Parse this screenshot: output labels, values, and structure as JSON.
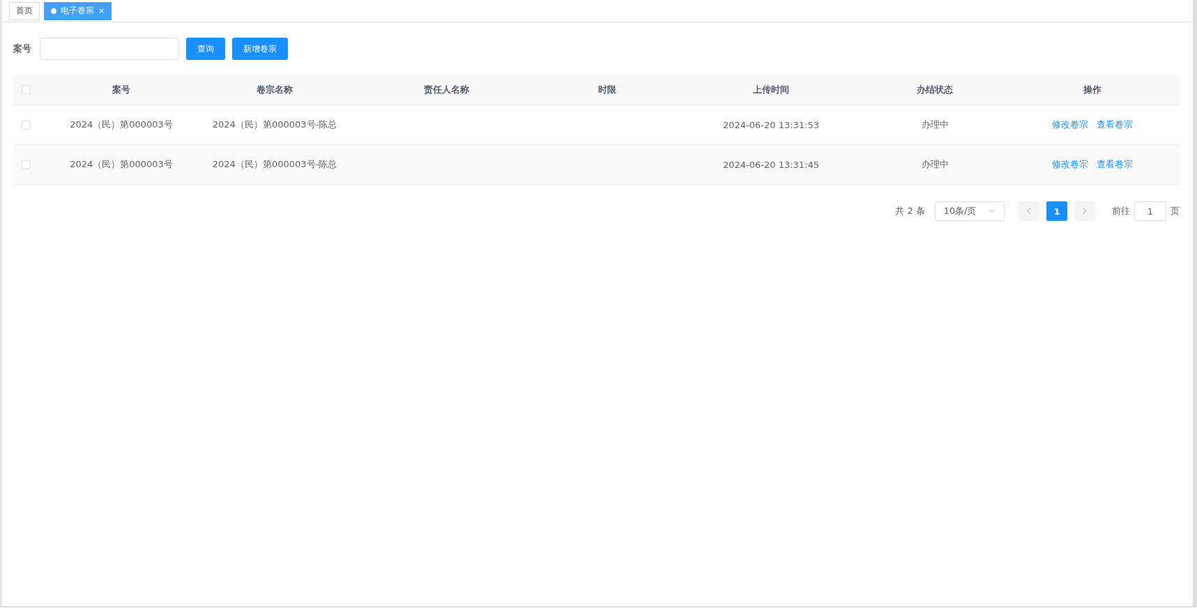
{
  "tabs": [
    {
      "label": "首页",
      "selected": false
    },
    {
      "label": "电子卷宗",
      "selected": true,
      "close": "×"
    }
  ],
  "search": {
    "label": "案号",
    "buttons": [
      "查询",
      "新增卷宗"
    ]
  },
  "table": {
    "select_all": {
      "checked": false
    },
    "columns": [
      "案号",
      "卷宗名称",
      "责任人名称",
      "时限",
      "上传时间",
      "办结状态",
      "操作"
    ],
    "rows": [
      {
        "checked": false,
        "cells": [
          "2024（民）第000003号",
          "2024（民）第000003号-陈总",
          "",
          "",
          "2024-06-20 13:31:53",
          "办理中"
        ],
        "actions": [
          "修改卷宗",
          "查看卷宗"
        ]
      },
      {
        "checked": false,
        "cells": [
          "2024（民）第000003号",
          "2024（民）第000003号-陈总",
          "",
          "",
          "2024-06-20 13:31:45",
          "办理中"
        ],
        "actions": [
          "修改卷宗",
          "查看卷宗"
        ]
      }
    ]
  },
  "pagination": {
    "total": "共 2 条",
    "page_size": "10条/页",
    "pages": [
      {
        "label": "1",
        "selected": true
      }
    ],
    "goto_label": "前往",
    "goto_value": "1",
    "goto_suffix": "页"
  }
}
